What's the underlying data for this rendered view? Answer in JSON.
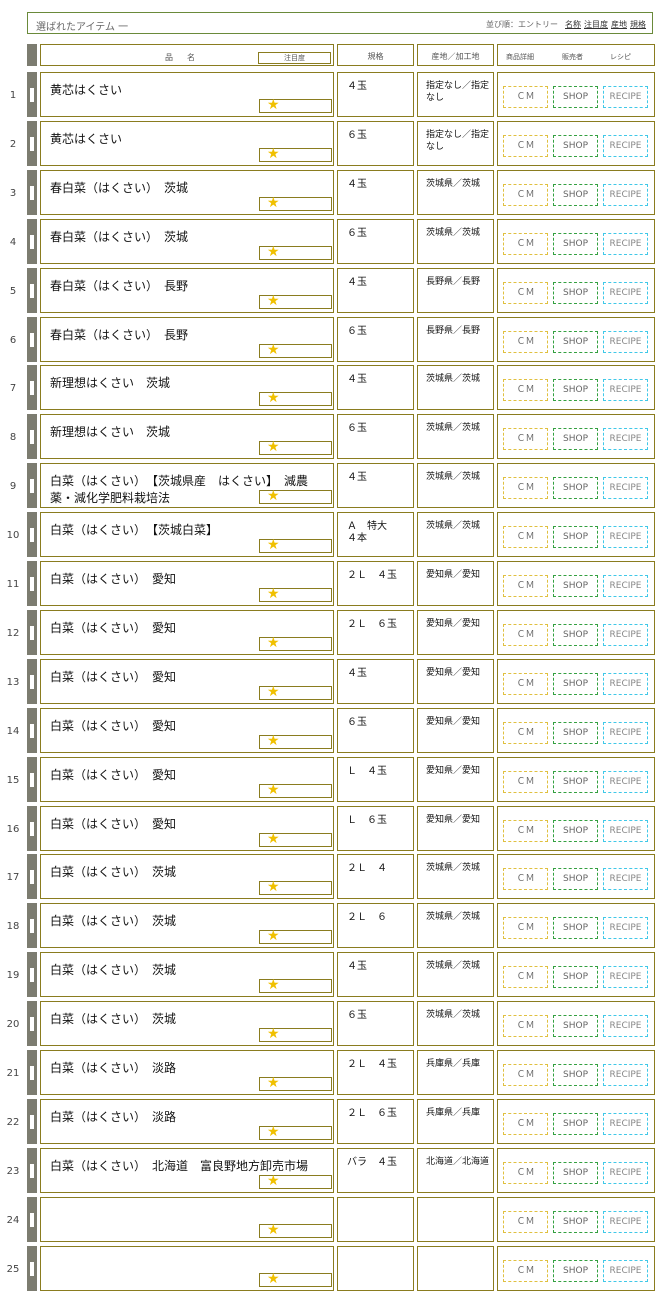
{
  "header": {
    "title": "選ばれたアイテム 一",
    "sort_label": "並び順：エントリー",
    "sort_links": [
      "名称",
      "注目度",
      "産地",
      "規格"
    ]
  },
  "columns": {
    "name": "品名",
    "attention": "注目度",
    "spec": "規格",
    "origin": "産地／加工地",
    "detail": "商品詳細",
    "seller": "販売者",
    "recipe": "レシピ"
  },
  "buttons": {
    "cm": "ＣＭ",
    "shop": "SHOP",
    "recipe": "RECIPE"
  },
  "rows": [
    {
      "num": "1",
      "name": "黄芯はくさい",
      "spec": "４玉",
      "origin": "指定なし／指定なし"
    },
    {
      "num": "2",
      "name": "黄芯はくさい",
      "spec": "６玉",
      "origin": "指定なし／指定なし"
    },
    {
      "num": "3",
      "name": "春白菜（はくさい）　茨城",
      "spec": "４玉",
      "origin": "茨城県／茨城"
    },
    {
      "num": "4",
      "name": "春白菜（はくさい）　茨城",
      "spec": "６玉",
      "origin": "茨城県／茨城"
    },
    {
      "num": "5",
      "name": "春白菜（はくさい）　長野",
      "spec": "４玉",
      "origin": "長野県／長野"
    },
    {
      "num": "6",
      "name": "春白菜（はくさい）　長野",
      "spec": "６玉",
      "origin": "長野県／長野"
    },
    {
      "num": "7",
      "name": "新理想はくさい　茨城",
      "spec": "４玉",
      "origin": "茨城県／茨城"
    },
    {
      "num": "8",
      "name": "新理想はくさい　茨城",
      "spec": "６玉",
      "origin": "茨城県／茨城"
    },
    {
      "num": "9",
      "name": "白菜（はくさい）　【茨城県産　はくさい】　減農薬・減化学肥料栽培法",
      "spec": "４玉",
      "origin": "茨城県／茨城"
    },
    {
      "num": "10",
      "name": "白菜（はくさい）　【茨城白菜】",
      "spec": "Ａ　特大\n４本",
      "origin": "茨城県／茨城"
    },
    {
      "num": "11",
      "name": "白菜（はくさい）　愛知",
      "spec": "２Ｌ　４玉",
      "origin": "愛知県／愛知"
    },
    {
      "num": "12",
      "name": "白菜（はくさい）　愛知",
      "spec": "２Ｌ　６玉",
      "origin": "愛知県／愛知"
    },
    {
      "num": "13",
      "name": "白菜（はくさい）　愛知",
      "spec": "４玉",
      "origin": "愛知県／愛知"
    },
    {
      "num": "14",
      "name": "白菜（はくさい）　愛知",
      "spec": "６玉",
      "origin": "愛知県／愛知"
    },
    {
      "num": "15",
      "name": "白菜（はくさい）　愛知",
      "spec": "Ｌ　４玉",
      "origin": "愛知県／愛知"
    },
    {
      "num": "16",
      "name": "白菜（はくさい）　愛知",
      "spec": "Ｌ　６玉",
      "origin": "愛知県／愛知"
    },
    {
      "num": "17",
      "name": "白菜（はくさい）　茨城",
      "spec": "２Ｌ　４",
      "origin": "茨城県／茨城"
    },
    {
      "num": "18",
      "name": "白菜（はくさい）　茨城",
      "spec": "２Ｌ　６",
      "origin": "茨城県／茨城"
    },
    {
      "num": "19",
      "name": "白菜（はくさい）　茨城",
      "spec": "４玉",
      "origin": "茨城県／茨城"
    },
    {
      "num": "20",
      "name": "白菜（はくさい）　茨城",
      "spec": "６玉",
      "origin": "茨城県／茨城"
    },
    {
      "num": "21",
      "name": "白菜（はくさい）　淡路",
      "spec": "２Ｌ　４玉",
      "origin": "兵庫県／兵庫"
    },
    {
      "num": "22",
      "name": "白菜（はくさい）　淡路",
      "spec": "２Ｌ　６玉",
      "origin": "兵庫県／兵庫"
    },
    {
      "num": "23",
      "name": "白菜（はくさい）　北海道　富良野地方卸売市場",
      "spec": "バラ　４玉",
      "origin": "北海道／北海道"
    },
    {
      "num": "24",
      "name": "",
      "spec": "",
      "origin": ""
    },
    {
      "num": "25",
      "name": "",
      "spec": "",
      "origin": ""
    }
  ],
  "icons": {
    "attention": "star-icon"
  },
  "colors": {
    "border": "#8a7c1f",
    "bar": "#7c7c70",
    "star": "#f0c000",
    "cm": "#e0c040",
    "shop": "#33a040",
    "recipe": "#40c8e8"
  }
}
